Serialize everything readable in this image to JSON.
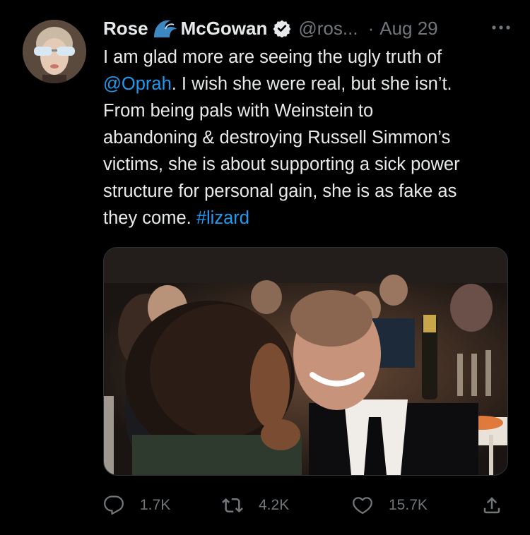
{
  "user": {
    "name": "Rose",
    "name_suffix": "McGowan",
    "handle": "@ros...",
    "separator": "·",
    "date": "Aug 29"
  },
  "tweet": {
    "line1": "I am glad more are seeing the ugly  truth of",
    "mention": "@Oprah",
    "line2_rest": ". I wish she were real, but she isn’t.",
    "line3": "From being pals with Weinstein to",
    "line4": "abandoning & destroying Russell Simmon’s",
    "line5": "victims, she is about supporting a sick power",
    "line6": "structure for personal gain, she is as fake as",
    "line7": "they come. ",
    "hashtag": "#lizard"
  },
  "actions": {
    "reply_count": "1.7K",
    "retweet_count": "4.2K",
    "like_count": "15.7K"
  },
  "colors": {
    "background": "#000000",
    "text": "#e7e9ea",
    "secondary": "#71767b",
    "link": "#1d9bf0",
    "wave": "#3b88c3"
  },
  "icons": [
    "wave-emoji-icon",
    "verified-icon",
    "more-icon",
    "reply-icon",
    "retweet-icon",
    "like-icon",
    "share-icon"
  ]
}
